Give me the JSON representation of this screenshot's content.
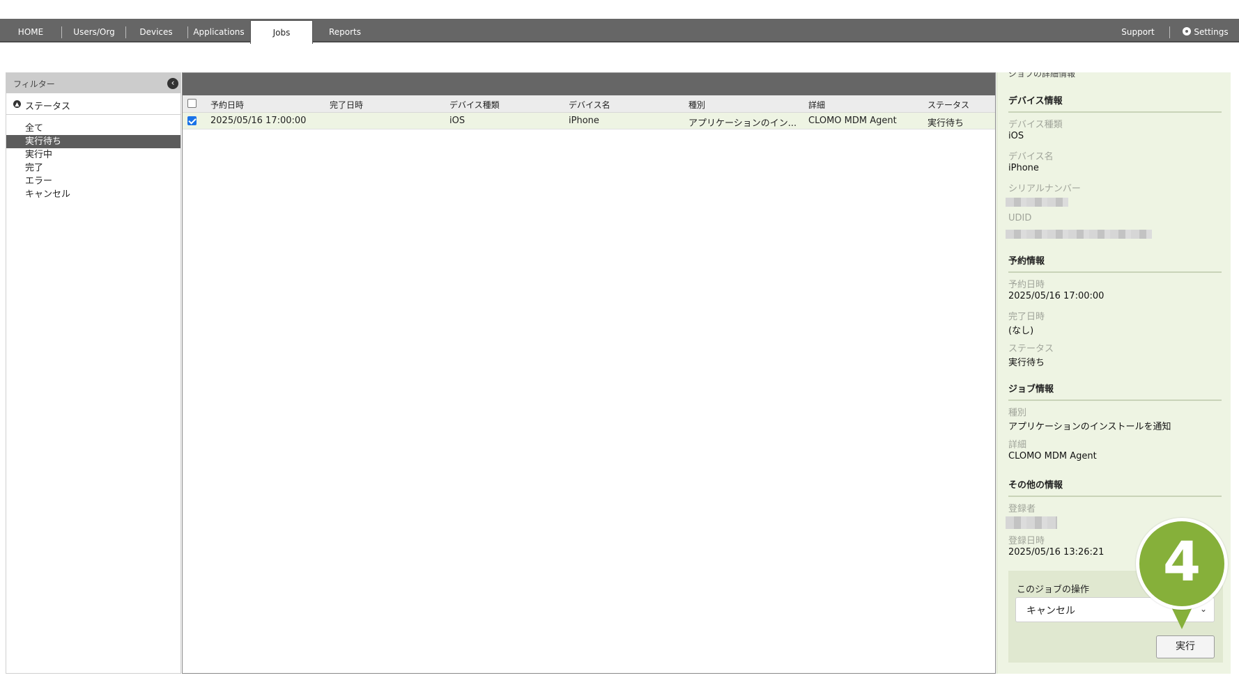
{
  "nav": {
    "items": [
      "HOME",
      "Users/Org",
      "Devices",
      "Applications",
      "Jobs",
      "Reports"
    ],
    "active": "Jobs",
    "support": "Support",
    "settings": "Settings"
  },
  "filter": {
    "title": "フィルター",
    "status_header": "ステータス",
    "status_items": [
      "全て",
      "実行待ち",
      "実行中",
      "完了",
      "エラー",
      "キャンセル"
    ],
    "selected": "実行待ち"
  },
  "table": {
    "columns": [
      "予約日時",
      "完了日時",
      "デバイス種類",
      "デバイス名",
      "種別",
      "詳細",
      "ステータス"
    ],
    "rows": [
      {
        "checked": true,
        "scheduled": "2025/05/16 17:00:00",
        "completed": "",
        "device_type": "iOS",
        "device_name": "iPhone",
        "kind": "アプリケーションのイン...",
        "detail": "CLOMO MDM Agent",
        "status": "実行待ち"
      }
    ]
  },
  "detail": {
    "header": "ジョブの詳細情報",
    "device_section": "デバイス情報",
    "device_type_label": "デバイス種類",
    "device_type": "iOS",
    "device_name_label": "デバイス名",
    "device_name": "iPhone",
    "serial_label": "シリアルナンバー",
    "udid_label": "UDID",
    "schedule_section": "予約情報",
    "scheduled_label": "予約日時",
    "scheduled": "2025/05/16 17:00:00",
    "completed_label": "完了日時",
    "completed": "(なし)",
    "status_label": "ステータス",
    "status": "実行待ち",
    "job_section": "ジョブ情報",
    "kind_label": "種別",
    "kind": "アプリケーションのインストールを通知",
    "detail_label": "詳細",
    "detail": "CLOMO MDM Agent",
    "other_section": "その他の情報",
    "registrant_label": "登録者",
    "registered_label": "登録日時",
    "registered": "2025/05/16 13:26:21"
  },
  "operation": {
    "label": "このジョブの操作",
    "selected": "キャンセル",
    "button": "実行"
  },
  "marker": {
    "number": "4",
    "color": "#86b03a"
  }
}
